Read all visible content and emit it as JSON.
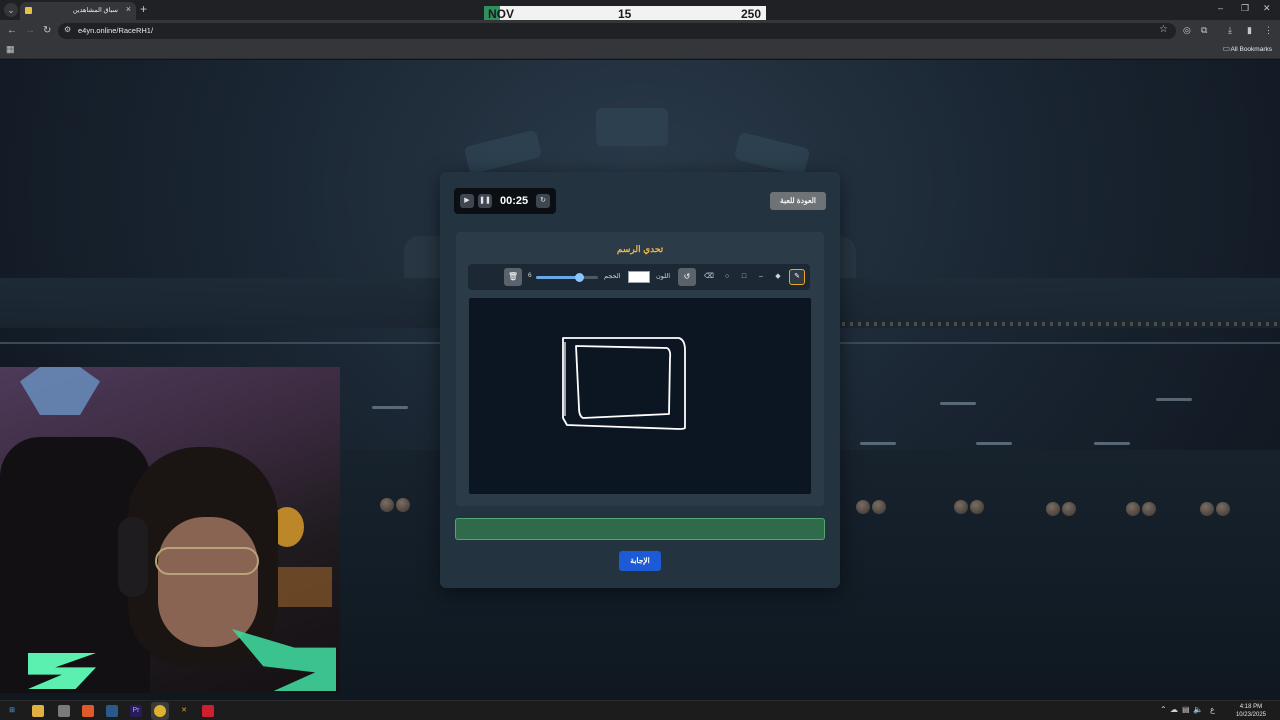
{
  "browser": {
    "tab_title": "سباق المشاهدين",
    "url": "e4yn.online/RaceRH1/",
    "all_bookmarks": "All Bookmarks"
  },
  "score_bar": {
    "month": "NOV",
    "value_a": "15",
    "value_b": "250",
    "badge_color": "#2f8f5f"
  },
  "game": {
    "timer": "00:25",
    "back_label": "العودة للعبة",
    "title": "تحدي الرسم",
    "toolbar": {
      "tools": [
        "pencil-icon",
        "fill-icon",
        "line-icon",
        "rectangle-icon",
        "circle-icon",
        "eraser-icon"
      ],
      "color_label": "اللون",
      "color_value": "#ffffff",
      "size_label": "الحجم",
      "size_value": "6",
      "size_fraction": 0.7
    },
    "answer_value": "",
    "answer_button": "الإجابة",
    "accent_color": "#f0b64a",
    "button_color": "#1c5ad6"
  },
  "taskbar": {
    "time": "4:18 PM",
    "date": "10/23/2025",
    "lang": "ع"
  }
}
